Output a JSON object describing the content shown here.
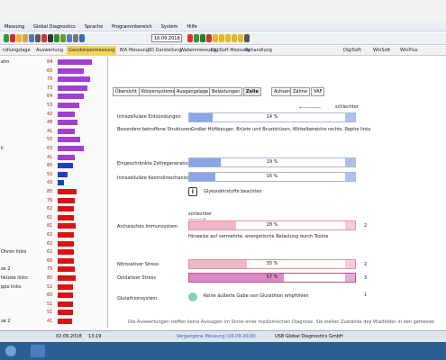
{
  "menu": [
    "Messung",
    "Global Diagnostics",
    "Sprache",
    "Programmbereich",
    "System",
    "Hilfe"
  ],
  "toolbar": {
    "date": "16.09.2018",
    "icons": [
      "green-circle",
      "red-circle",
      "yellow-circle",
      "folder",
      "save",
      "print",
      "chart",
      "barcode",
      "play",
      "chart2",
      "chart3",
      "tools",
      "help",
      "record",
      "play2",
      "forward",
      "stop",
      "num-1",
      "num-2",
      "num-3",
      "num-4",
      "num-5",
      "gear"
    ],
    "colors": [
      "#2e9e2e",
      "#cc2a2a",
      "#e8b62c",
      "#d7a34a",
      "#4a78b8",
      "#5a5a5a",
      "#c63a3a",
      "#333",
      "#2b8f2b",
      "#6a9b2c",
      "#4f7fbf",
      "#777",
      "#3a6ab0",
      "#d33",
      "#279b27",
      "#2a7a2a",
      "#c33",
      "#e4b92a",
      "#e4b92a",
      "#e4b92a",
      "#e4b92a",
      "#e4b92a",
      "#555"
    ]
  },
  "nav": [
    {
      "label": "ndlungslage",
      "active": false
    },
    {
      "label": "Auswertung",
      "active": false
    },
    {
      "label": "Ganzkörpermessung",
      "active": true
    },
    {
      "label": "BIA Messung",
      "active": false
    },
    {
      "label": "3D Darstellung",
      "active": false
    },
    {
      "label": "Wabenmessung",
      "active": false
    },
    {
      "label": "DigiSoft Messung",
      "active": false
    },
    {
      "label": "Behandlung",
      "active": false
    },
    {
      "label": "DigiSoft",
      "active": false
    },
    {
      "label": "WinSoft",
      "active": false
    },
    {
      "label": "WinPlus",
      "active": false
    }
  ],
  "left_rows": [
    {
      "label": "ahn",
      "value": "84",
      "color": "purple",
      "level": 100
    },
    {
      "label": "",
      "value": "65",
      "color": "purple",
      "level": 77
    },
    {
      "label": "",
      "value": "79",
      "color": "purple",
      "level": 94
    },
    {
      "label": "",
      "value": "73",
      "color": "purple",
      "level": 86
    },
    {
      "label": "",
      "value": "64",
      "color": "purple",
      "level": 76
    },
    {
      "label": "",
      "value": "53",
      "color": "purple",
      "level": 63
    },
    {
      "label": "",
      "value": "42",
      "color": "purple",
      "level": 50
    },
    {
      "label": "",
      "value": "48",
      "color": "purple",
      "level": 57
    },
    {
      "label": "",
      "value": "41",
      "color": "purple",
      "level": 49
    },
    {
      "label": "",
      "value": "55",
      "color": "purple",
      "level": 65
    },
    {
      "label": "k",
      "value": "63",
      "color": "purple",
      "level": 75
    },
    {
      "label": "",
      "value": "41",
      "color": "purple",
      "level": 49
    },
    {
      "label": "",
      "value": "85",
      "color": "blue",
      "level": 45
    },
    {
      "label": "",
      "value": "50",
      "color": "blue",
      "level": 28
    },
    {
      "label": "",
      "value": "43",
      "color": "blue",
      "level": 18
    },
    {
      "label": "",
      "value": "85",
      "color": "red",
      "level": 55
    },
    {
      "label": "",
      "value": "76",
      "color": "red",
      "level": 50
    },
    {
      "label": "",
      "value": "62",
      "color": "red",
      "level": 47
    },
    {
      "label": "",
      "value": "61",
      "color": "red",
      "level": 47
    },
    {
      "label": "",
      "value": "81",
      "color": "red",
      "level": 52
    },
    {
      "label": "",
      "value": "62",
      "color": "red",
      "level": 47
    },
    {
      "label": "",
      "value": "62",
      "color": "red",
      "level": 47
    },
    {
      "label": "Ohren links",
      "value": "62",
      "color": "red",
      "level": 47
    },
    {
      "label": "",
      "value": "66",
      "color": "red",
      "level": 48
    },
    {
      "label": "ze 2",
      "value": "75",
      "color": "red",
      "level": 50
    },
    {
      "label": "hküste links",
      "value": "80",
      "color": "red",
      "level": 52
    },
    {
      "label": "ppe links",
      "value": "52",
      "color": "red",
      "level": 45
    },
    {
      "label": "",
      "value": "60",
      "color": "red",
      "level": 46
    },
    {
      "label": "",
      "value": "51",
      "color": "red",
      "level": 45
    },
    {
      "label": "",
      "value": "51",
      "color": "red",
      "level": 45
    },
    {
      "label": "ze 2",
      "value": "41",
      "color": "red",
      "level": 43
    }
  ],
  "tabs": [
    {
      "label": "Übersicht",
      "active": false
    },
    {
      "label": "Körpersysteme",
      "active": false
    },
    {
      "label": "Ausgangslage",
      "active": false
    },
    {
      "label": "Belastungen",
      "active": false
    },
    {
      "label": "Zelle",
      "active": true
    },
    {
      "label": "Achsen",
      "active": false
    },
    {
      "label": "Zähne",
      "active": false
    },
    {
      "label": "VAF",
      "active": false
    }
  ],
  "cell": {
    "schlechter_top": "schlechter",
    "intra_label": "Intrazelluläre Entzündungen",
    "intra_pct": "14 %",
    "intra_val": 14,
    "structs_label": "Besonders betroffene Strukturen:",
    "structs_text": "Großer Hüftbeuger, Brüste und Brustdrüsen, Wirbelbereiche rechts, Rephe links",
    "degen_label": "Eingeschränkte Zellregeneration",
    "degen_pct": "19 %",
    "degen_val": 19,
    "ctrl_label": "Intrazelluläre Kontrollmechanismen",
    "ctrl_pct": "16 %",
    "ctrl_val": 16,
    "glyco": "Glykonährstoffe beachten",
    "schlechter_mid": "schlechter",
    "arch_label": "Archaisches Immunsystem",
    "arch_pct": "28 %",
    "arch_val": 28,
    "arch_num": "2",
    "arch_note": "Hinweise auf vermehrte, energetische Belastung durch Toxine",
    "nitro_label": "Nitrosativer Stress",
    "nitro_pct": "35 %",
    "nitro_val": 35,
    "nitro_num": "2",
    "oxid_label": "Oxidativer Stress",
    "oxid_pct": "57 %",
    "oxid_val": 57,
    "oxid_num": "3",
    "glut_label": "Glutathionsystem",
    "glut_text": "Keine äußerte Gabe von Glutathion empfohlen",
    "glut_num": "1",
    "footer": "Die Auswertungen treffen keine Aussagen im Sinne einer medizinischen Diagnose. Sie stellen Zustände des Vitalfeldes in den gemessenen Bereichen dar."
  },
  "status": {
    "date": "02.09.2018",
    "time": "13:19",
    "past": "Vergangene Messung (16.09.2018)",
    "company": "USB Global Diagnostics GmbH"
  }
}
